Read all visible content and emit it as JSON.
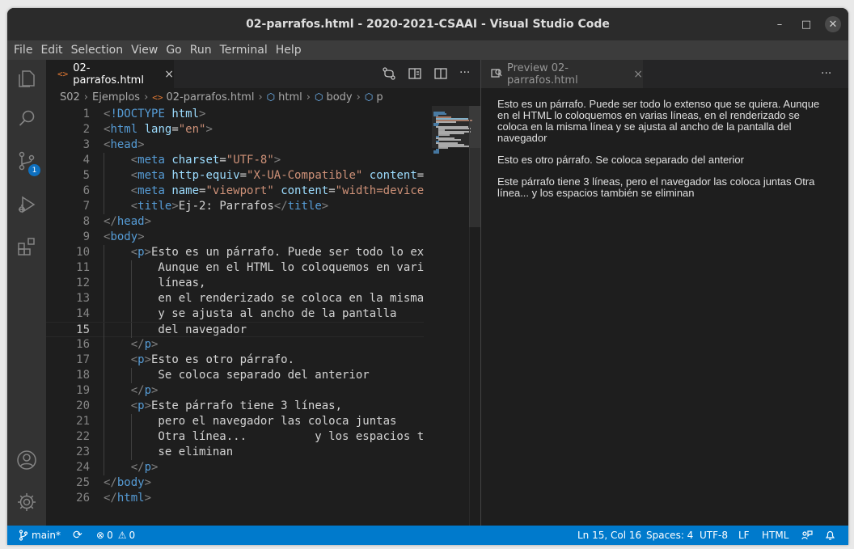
{
  "window": {
    "title": "02-parrafos.html - 2020-2021-CSAAI - Visual Studio Code",
    "minimize_glyph": "–",
    "maximize_glyph": "□",
    "close_glyph": "✕"
  },
  "menu": [
    "File",
    "Edit",
    "Selection",
    "View",
    "Go",
    "Run",
    "Terminal",
    "Help"
  ],
  "activity_bar": {
    "icons": [
      "explorer-icon",
      "search-icon",
      "source-control-icon",
      "run-debug-icon",
      "extensions-icon",
      "account-icon",
      "settings-gear-icon"
    ],
    "scm_badge": "1"
  },
  "editor": {
    "tab": {
      "icon_glyph": "<>",
      "label": "02-parrafos.html",
      "close_glyph": "×"
    },
    "actions": [
      "open-changes-icon",
      "open-preview-icon",
      "split-editor-icon",
      "more-actions-icon"
    ],
    "breadcrumbs": [
      "S02",
      "Ejemplos",
      "02-parrafos.html",
      "html",
      "body",
      "p"
    ],
    "current_line": 15,
    "lines": [
      [
        [
          "t-punc",
          "<"
        ],
        [
          "t-tag",
          "!DOCTYPE"
        ],
        [
          "t-txt",
          " "
        ],
        [
          "t-attr",
          "html"
        ],
        [
          "t-punc",
          ">"
        ]
      ],
      [
        [
          "t-punc",
          "<"
        ],
        [
          "t-tag",
          "html"
        ],
        [
          "t-txt",
          " "
        ],
        [
          "t-attr",
          "lang"
        ],
        [
          "t-txt",
          "="
        ],
        [
          "t-str",
          "\"en\""
        ],
        [
          "t-punc",
          ">"
        ]
      ],
      [
        [
          "t-punc",
          "<"
        ],
        [
          "t-tag",
          "head"
        ],
        [
          "t-punc",
          ">"
        ]
      ],
      [
        [
          "t-txt",
          "    "
        ],
        [
          "t-punc",
          "<"
        ],
        [
          "t-tag",
          "meta"
        ],
        [
          "t-txt",
          " "
        ],
        [
          "t-attr",
          "charset"
        ],
        [
          "t-txt",
          "="
        ],
        [
          "t-str",
          "\"UTF-8\""
        ],
        [
          "t-punc",
          ">"
        ]
      ],
      [
        [
          "t-txt",
          "    "
        ],
        [
          "t-punc",
          "<"
        ],
        [
          "t-tag",
          "meta"
        ],
        [
          "t-txt",
          " "
        ],
        [
          "t-attr",
          "http-equiv"
        ],
        [
          "t-txt",
          "="
        ],
        [
          "t-str",
          "\"X-UA-Compatible\""
        ],
        [
          "t-txt",
          " "
        ],
        [
          "t-attr",
          "content"
        ],
        [
          "t-txt",
          "="
        ]
      ],
      [
        [
          "t-txt",
          "    "
        ],
        [
          "t-punc",
          "<"
        ],
        [
          "t-tag",
          "meta"
        ],
        [
          "t-txt",
          " "
        ],
        [
          "t-attr",
          "name"
        ],
        [
          "t-txt",
          "="
        ],
        [
          "t-str",
          "\"viewport\""
        ],
        [
          "t-txt",
          " "
        ],
        [
          "t-attr",
          "content"
        ],
        [
          "t-txt",
          "="
        ],
        [
          "t-str",
          "\"width=device"
        ]
      ],
      [
        [
          "t-txt",
          "    "
        ],
        [
          "t-punc",
          "<"
        ],
        [
          "t-tag",
          "title"
        ],
        [
          "t-punc",
          ">"
        ],
        [
          "t-txt",
          "Ej-2: Parrafos"
        ],
        [
          "t-punc",
          "</"
        ],
        [
          "t-tag",
          "title"
        ],
        [
          "t-punc",
          ">"
        ]
      ],
      [
        [
          "t-punc",
          "</"
        ],
        [
          "t-tag",
          "head"
        ],
        [
          "t-punc",
          ">"
        ]
      ],
      [
        [
          "t-punc",
          "<"
        ],
        [
          "t-tag",
          "body"
        ],
        [
          "t-punc",
          ">"
        ]
      ],
      [
        [
          "t-txt",
          "    "
        ],
        [
          "t-punc",
          "<"
        ],
        [
          "t-tag",
          "p"
        ],
        [
          "t-punc",
          ">"
        ],
        [
          "t-txt",
          "Esto es un párrafo. Puede ser todo lo ex"
        ]
      ],
      [
        [
          "t-txt",
          "        Aunque en el HTML lo coloquemos en vari"
        ]
      ],
      [
        [
          "t-txt",
          "        líneas,"
        ]
      ],
      [
        [
          "t-txt",
          "        en el renderizado se coloca en la misma"
        ]
      ],
      [
        [
          "t-txt",
          "        y se ajusta al ancho de la pantalla"
        ]
      ],
      [
        [
          "t-txt",
          "        del navegador"
        ]
      ],
      [
        [
          "t-txt",
          "    "
        ],
        [
          "t-punc",
          "</"
        ],
        [
          "t-tag",
          "p"
        ],
        [
          "t-punc",
          ">"
        ]
      ],
      [
        [
          "t-txt",
          "    "
        ],
        [
          "t-punc",
          "<"
        ],
        [
          "t-tag",
          "p"
        ],
        [
          "t-punc",
          ">"
        ],
        [
          "t-txt",
          "Esto es otro párrafo."
        ]
      ],
      [
        [
          "t-txt",
          "        Se coloca separado del anterior"
        ]
      ],
      [
        [
          "t-txt",
          "    "
        ],
        [
          "t-punc",
          "</"
        ],
        [
          "t-tag",
          "p"
        ],
        [
          "t-punc",
          ">"
        ]
      ],
      [
        [
          "t-txt",
          "    "
        ],
        [
          "t-punc",
          "<"
        ],
        [
          "t-tag",
          "p"
        ],
        [
          "t-punc",
          ">"
        ],
        [
          "t-txt",
          "Este párrafo tiene 3 líneas,"
        ]
      ],
      [
        [
          "t-txt",
          "        pero el navegador las coloca juntas"
        ]
      ],
      [
        [
          "t-txt",
          "        Otra línea...          y los espacios t"
        ]
      ],
      [
        [
          "t-txt",
          "        se eliminan"
        ]
      ],
      [
        [
          "t-txt",
          "    "
        ],
        [
          "t-punc",
          "</"
        ],
        [
          "t-tag",
          "p"
        ],
        [
          "t-punc",
          ">"
        ]
      ],
      [
        [
          "t-punc",
          "</"
        ],
        [
          "t-tag",
          "body"
        ],
        [
          "t-punc",
          ">"
        ]
      ],
      [
        [
          "t-punc",
          "</"
        ],
        [
          "t-tag",
          "html"
        ],
        [
          "t-punc",
          ">"
        ]
      ]
    ]
  },
  "preview": {
    "tab": {
      "label": "Preview 02-parrafos.html",
      "close_glyph": "×"
    },
    "more_glyph": "···",
    "paragraphs": [
      "Esto es un párrafo. Puede ser todo lo extenso que se quiera. Aunque en el HTML lo coloquemos en varias líneas, en el renderizado se coloca en la misma línea y se ajusta al ancho de la pantalla del navegador",
      "Esto es otro párrafo. Se coloca separado del anterior",
      "Este párrafo tiene 3 líneas, pero el navegador las coloca juntas Otra línea... y los espacios también se eliminan"
    ]
  },
  "status_bar": {
    "branch": "main*",
    "sync": "⟳",
    "errors": "0",
    "warnings": "0",
    "position": "Ln 15, Col 16",
    "spaces": "Spaces: 4",
    "encoding": "UTF-8",
    "eol": "LF",
    "language": "HTML"
  },
  "colors": {
    "status_bar": "#007acc",
    "editor_bg": "#1e1e1e",
    "tag": "#569cd6",
    "attribute": "#9cdcfe",
    "string": "#ce9178"
  }
}
